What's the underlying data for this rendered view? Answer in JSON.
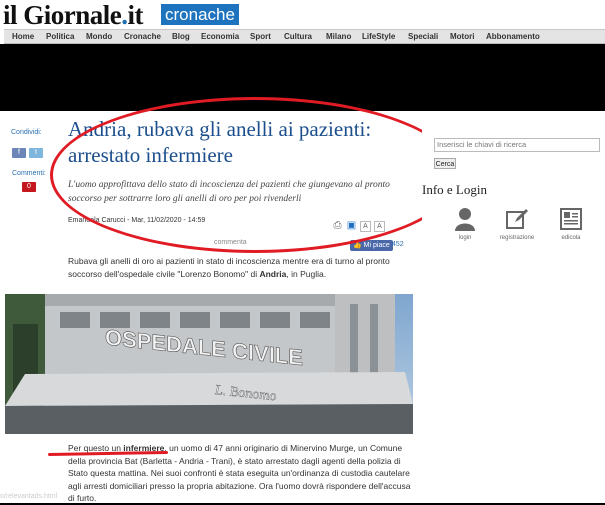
{
  "header": {
    "logo_main": "il Giornale",
    "logo_dot": ".",
    "logo_suffix": "it",
    "section": "cronache",
    "nav": [
      "Home",
      "Politica",
      "Mondo",
      "Cronache",
      "Blog",
      "Economia",
      "Sport",
      "Cultura",
      "Milano",
      "LifeStyle",
      "Speciali",
      "Motori",
      "Abbonamento"
    ]
  },
  "share": {
    "label": "Condividi:",
    "facebook": "f",
    "twitter": "t",
    "comments_label": "Commenti:",
    "comments_count": "0"
  },
  "article": {
    "title": "Andria, rubava gli anelli ai pazienti: arrestato infermiere",
    "subtitle": "L'uomo approfittava dello stato di incoscienza dei pazienti che giungevano al pronto soccorso per sottrarre loro gli anelli di oro per poi rivenderli",
    "byline": "Emanuela Carucci - Mar, 11/02/2020 - 14:59",
    "comments_link": "commenta",
    "like_label": "Mi piace",
    "like_count": "452",
    "lead_text_1": "Rubava gli anelli di oro ai pazienti in stato di incoscienza mentre era di turno al pronto soccorso dell'ospedale civile \"Lorenzo Bonomo\" di ",
    "lead_bold": "Andria",
    "lead_text_2": ", in Puglia.",
    "photo_sign_1": "OSPEDALE CIVILE",
    "photo_sign_2": "L. Bonomo",
    "body_intro": "Per questo un ",
    "body_bold": "infermiere",
    "body_rest": ", un uomo di 47 anni originario di Minervino Murge, un Comune della provincia Bat (Barletta - Andria - Trani), è stato arrestato dagli agenti della polizia di Stato questa mattina. Nei suoi confronti è stata eseguita un'ordinanza di custodia cautelare agli arresti domiciliari presso la propria abitazione. Ora l'uomo dovrà rispondere dell'accusa di furto."
  },
  "sidebar": {
    "search_placeholder": "Inserisci le chiavi di ricerca",
    "search_button": "Cerca",
    "info_title": "Info e Login",
    "icons": [
      {
        "label": "login",
        "icon": "person-icon"
      },
      {
        "label": "registrazione",
        "icon": "edit-icon"
      },
      {
        "label": "edicola",
        "icon": "newspaper-icon"
      }
    ]
  },
  "status_bar": {
    "url": "o/relevantads.html"
  },
  "colors": {
    "brand_blue": "#1e73be",
    "title_blue": "#1b4e8c",
    "annotation_red": "#e01b24"
  }
}
